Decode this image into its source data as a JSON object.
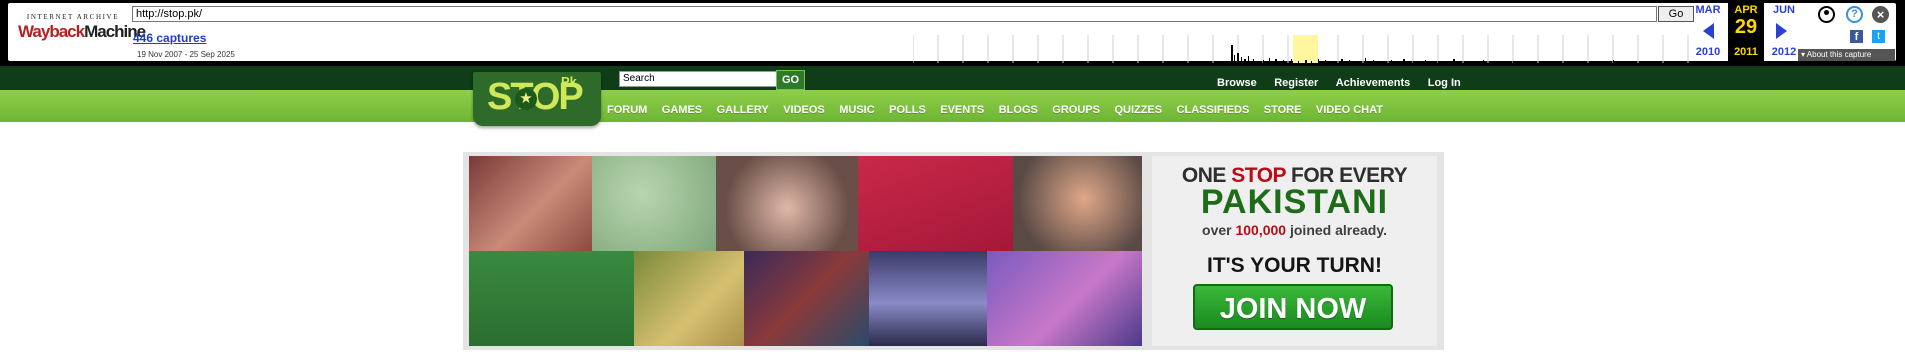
{
  "wayback": {
    "logo_line1": "INTERNET ARCHIVE",
    "logo_wayback": "Wayback",
    "logo_machine": "Machine",
    "url": "http://stop.pk/",
    "go_label": "Go",
    "captures_label": "446 captures",
    "date_range": "19 Nov 2007 - 25 Sep 2025",
    "calendar": {
      "prev_month": "MAR",
      "prev_year": "2010",
      "current_month": "APR",
      "current_day": "29",
      "current_year": "2011",
      "next_month": "JUN",
      "next_year": "2012"
    },
    "about_label": "About this capture",
    "icons": [
      "user-icon",
      "help-icon",
      "close-icon",
      "facebook-icon",
      "twitter-icon"
    ]
  },
  "site": {
    "logo_text": "STOP",
    "logo_suffix": "Pk",
    "search_placeholder": "Search",
    "search_go": "GO",
    "top_links": [
      "Browse",
      "Register",
      "Achievements",
      "Log In"
    ],
    "menu": [
      "FORUM",
      "GAMES",
      "GALLERY",
      "VIDEOS",
      "MUSIC",
      "POLLS",
      "EVENTS",
      "BLOGS",
      "GROUPS",
      "QUIZZES",
      "CLASSIFIEDS",
      "STORE",
      "VIDEO CHAT"
    ],
    "colors": {
      "header_dark": "#0e3d17",
      "nav_green": "#7fc23f",
      "accent_red": "#b80d16",
      "brand_green": "#1e6c1a"
    }
  },
  "banner": {
    "line1_a": "ONE ",
    "line1_b": "STOP",
    "line1_c": " FOR EVERY",
    "line2": "PAKISTANI",
    "line3_a": "over ",
    "line3_b": "100,000",
    "line3_c": " joined already.",
    "line4": "IT'S YOUR TURN!",
    "join_label": "JOIN NOW"
  }
}
